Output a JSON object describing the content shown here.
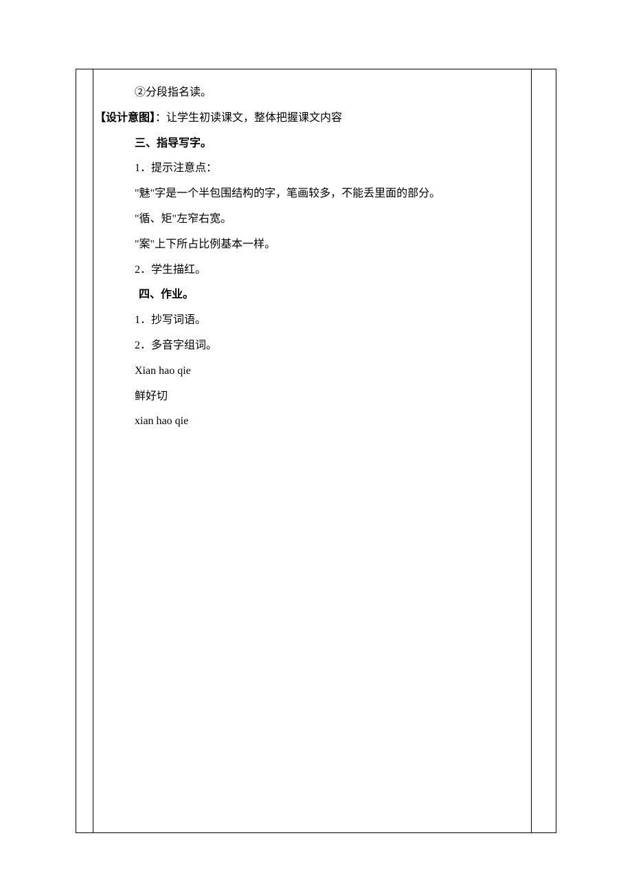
{
  "content": {
    "line1": "②分段指名读。",
    "design_intent_label": "【设计意图】",
    "design_intent_text": "：让学生初读课文，整体把握课文内容",
    "section3_title": "三、指导写字。",
    "line3_1": "1．提示注意点：",
    "line3_2": "\"魅\"字是一个半包围结构的字，笔画较多，不能丢里面的部分。",
    "line3_3": "\"循、矩\"左窄右宽。",
    "line3_4": "\"案\"上下所占比例基本一样。",
    "line3_5": "2．学生描红。",
    "section4_title": "四、作业。",
    "line4_1": "1．抄写词语。",
    "line4_2": "2．多音字组词。",
    "line4_3": "Xian hao qie",
    "line4_4": "鲜好切",
    "line4_5": "xian hao qie"
  }
}
